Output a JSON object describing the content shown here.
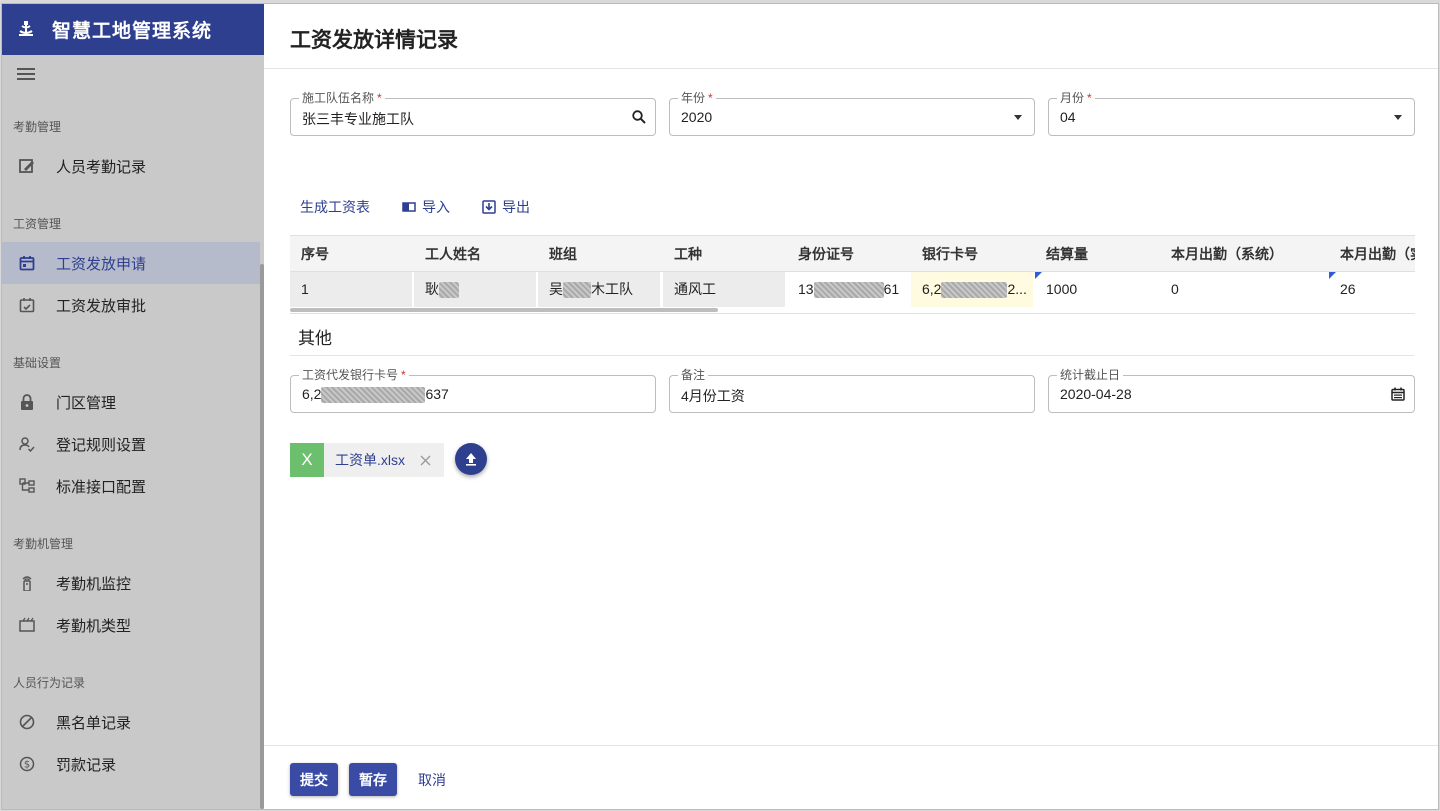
{
  "app": {
    "title": "智慧工地管理系统"
  },
  "sidebar": {
    "sections": [
      {
        "label": "考勤管理",
        "items": [
          {
            "label": "人员考勤记录",
            "icon": "edit-note-icon"
          }
        ]
      },
      {
        "label": "工资管理",
        "items": [
          {
            "label": "工资发放申请",
            "icon": "calendar-icon",
            "active": true
          },
          {
            "label": "工资发放审批",
            "icon": "calendar-check-icon"
          }
        ]
      },
      {
        "label": "基础设置",
        "items": [
          {
            "label": "门区管理",
            "icon": "lock-icon"
          },
          {
            "label": "登记规则设置",
            "icon": "person-check-icon"
          },
          {
            "label": "标准接口配置",
            "icon": "tree-icon"
          }
        ]
      },
      {
        "label": "考勤机管理",
        "items": [
          {
            "label": "考勤机监控",
            "icon": "remote-icon"
          },
          {
            "label": "考勤机类型",
            "icon": "clapper-icon"
          }
        ]
      },
      {
        "label": "人员行为记录",
        "items": [
          {
            "label": "黑名单记录",
            "icon": "block-icon"
          },
          {
            "label": "罚款记录",
            "icon": "dollar-circle-icon"
          }
        ]
      }
    ]
  },
  "page": {
    "title": "工资发放详情记录"
  },
  "form": {
    "team": {
      "label": "施工队伍名称",
      "value": "张三丰专业施工队"
    },
    "year": {
      "label": "年份",
      "value": "2020"
    },
    "month": {
      "label": "月份",
      "value": "04"
    }
  },
  "toolbar": {
    "generate": "生成工资表",
    "import": "导入",
    "export": "导出"
  },
  "table": {
    "headers": [
      "序号",
      "工人姓名",
      "班组",
      "工种",
      "身份证号",
      "银行卡号",
      "结算量",
      "本月出勤（系统）",
      "本月出勤（实"
    ],
    "row": {
      "seq": "1",
      "name_prefix": "耿",
      "team_prefix": "吴",
      "team_suffix": "木工队",
      "trade": "通风工",
      "id_prefix": "13",
      "id_suffix": "61",
      "card_prefix": "6,2",
      "card_suffix": "2...",
      "settle": "1000",
      "attend_sys": "0",
      "attend_real": "26"
    }
  },
  "other": {
    "title": "其他",
    "bank_card": {
      "label": "工资代发银行卡号",
      "prefix": "6,2",
      "suffix": "637"
    },
    "remark": {
      "label": "备注",
      "value": "4月份工资"
    },
    "cutoff": {
      "label": "统计截止日",
      "value": "2020-04-28"
    }
  },
  "attachment": {
    "file_icon_letter": "X",
    "filename": "工资单.xlsx"
  },
  "footer": {
    "submit": "提交",
    "save_draft": "暂存",
    "cancel": "取消"
  },
  "colors": {
    "brand": "#2e3f8f",
    "required": "#d32f2f",
    "excel": "#6cbf6c"
  }
}
